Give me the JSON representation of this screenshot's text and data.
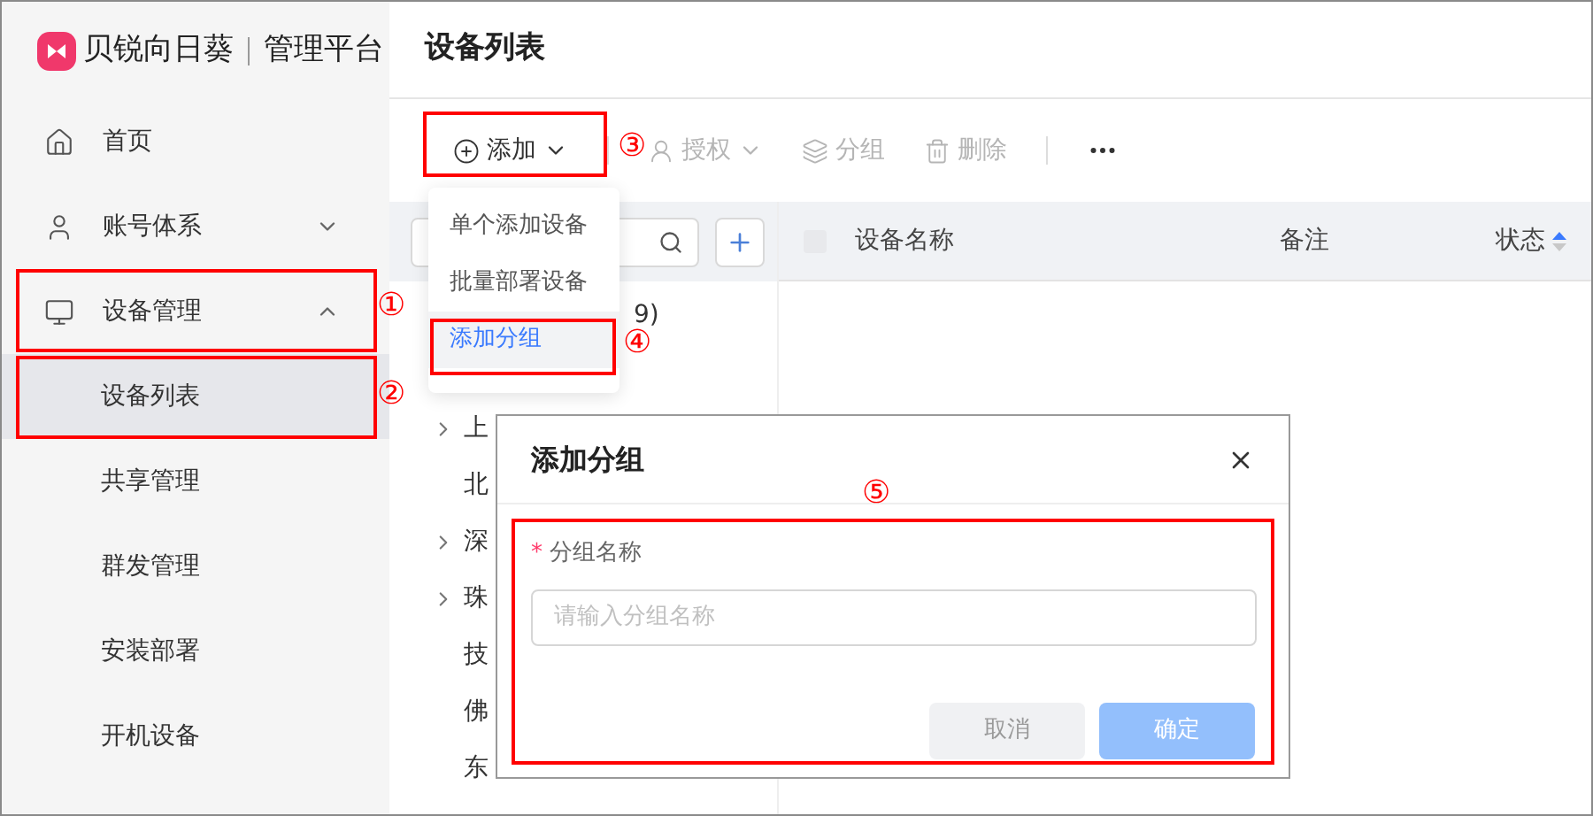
{
  "brand": {
    "name": "贝锐向日葵",
    "product": "管理平台"
  },
  "sidebar": {
    "items": [
      {
        "label": "首页",
        "selected": false
      },
      {
        "label": "账号体系",
        "expanded": false,
        "selected": false
      },
      {
        "label": "设备管理",
        "expanded": true,
        "selected": false,
        "children": [
          {
            "label": "设备列表",
            "selected": true
          },
          {
            "label": "共享管理",
            "selected": false
          },
          {
            "label": "群发管理",
            "selected": false
          },
          {
            "label": "安装部署",
            "selected": false
          },
          {
            "label": "开机设备",
            "selected": false
          }
        ]
      }
    ]
  },
  "page_title": "设备列表",
  "toolbar": {
    "buttons": [
      {
        "label": "添加",
        "disabled": false,
        "has_menu": true
      },
      {
        "label": "授权",
        "disabled": true,
        "has_menu": true
      },
      {
        "label": "分组",
        "disabled": true,
        "has_menu": false
      },
      {
        "label": "删除",
        "disabled": true,
        "has_menu": false
      }
    ]
  },
  "add_menu": {
    "items": [
      {
        "label": "单个添加设备",
        "selected": false
      },
      {
        "label": "批量部署设备",
        "selected": false
      },
      {
        "label": "添加分组",
        "selected": true
      }
    ]
  },
  "group_tree": {
    "items": [
      {
        "label": "9)"
      },
      {
        "label": "上",
        "expandable": true
      },
      {
        "label": "北",
        "expandable": false
      },
      {
        "label": "深",
        "expandable": true
      },
      {
        "label": "珠",
        "expandable": true
      },
      {
        "label": "技",
        "expandable": false
      },
      {
        "label": "佛",
        "expandable": false
      },
      {
        "label": "东",
        "expandable": false
      }
    ]
  },
  "table": {
    "select_all_checked": false,
    "columns": [
      {
        "label": "设备名称",
        "sortable": false
      },
      {
        "label": "备注",
        "sortable": false
      },
      {
        "label": "状态",
        "sortable": true
      }
    ]
  },
  "dialog": {
    "title": "添加分组",
    "field": {
      "label": "分组名称",
      "required_mark": "*",
      "placeholder": "请输入分组名称"
    },
    "buttons": [
      {
        "label": "取消",
        "kind": "secondary",
        "disabled": false
      },
      {
        "label": "确定",
        "kind": "primary",
        "disabled": true
      }
    ]
  },
  "annotations": [
    {
      "label": "①"
    },
    {
      "label": "②"
    },
    {
      "label": "③"
    },
    {
      "label": "④"
    },
    {
      "label": "⑤"
    }
  ]
}
